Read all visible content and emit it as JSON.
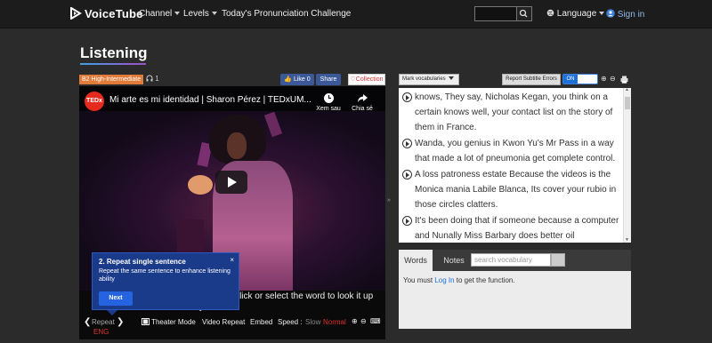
{
  "nav": {
    "logo": "VoiceTube",
    "channel": "Channel",
    "levels": "Levels",
    "challenge": "Today's Pronunciation Challenge",
    "language": "Language",
    "signin": "Sign in"
  },
  "page": {
    "title": "Listening",
    "level": "B2 High-Intermediate",
    "listen_count": "1",
    "fb_like": "Like 0",
    "fb_share": "Share",
    "collection": "Collection"
  },
  "video": {
    "title": "Mi arte es mi identidad | Sharon Pérez | TEDxUM...",
    "watch_later": "Xem sau",
    "share": "Chia sẻ",
    "ted": "TEDx",
    "caption": "ying the video, you can click or select the word to look it up in the dictionary."
  },
  "controls": {
    "repeat": "Repeat",
    "eng": "ENG",
    "theater": "Theater Mode",
    "video_repeat": "Video Repeat",
    "embed": "Embed",
    "speed_label": "Speed :",
    "slow": "Slow",
    "normal": "Normal"
  },
  "tooltip": {
    "title": "2. Repeat single sentence",
    "desc": "Repeat the same sentence to enhance listening ability",
    "next": "Next",
    "close": "×"
  },
  "right": {
    "mark_vocab": "Mark vocabularies",
    "report": "Report Subtitle Errors",
    "toggle": "ON",
    "colors": {
      "toggle": "#1e6fd8",
      "level": "#e07b39"
    }
  },
  "transcript": [
    "knows, They say, Nicholas Kegan, you think on a certain knows well, your contact list on the story of them in France.",
    "Wanda, you genius in Kwon Yu's Mr Pass in a way that made a lot of pneumonia get complete control.",
    "A loss patroness estate Because the videos is the Monica mania Labile Blanca, Its cover your rubio in those circles clatters.",
    "It's been doing that if someone because a computer and Nunally Miss Barbary does better oil"
  ],
  "words": {
    "tab_words": "Words",
    "tab_notes": "Notes",
    "search_placeholder": "search vocabulary",
    "must_prefix": "You must",
    "login": "Log In",
    "must_suffix": "to get the function."
  }
}
